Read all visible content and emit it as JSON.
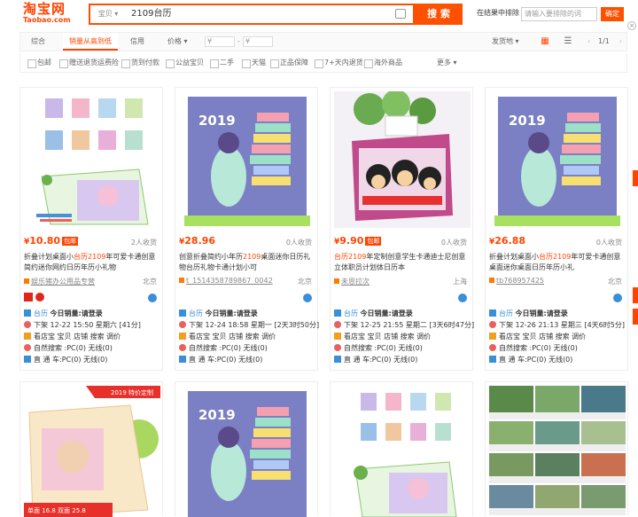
{
  "header": {
    "logo_cn": "淘宝网",
    "logo_en": "Taobao.com",
    "category": "宝贝",
    "search_value": "2109台历",
    "search_button": "搜 索",
    "search_in_results_label": "在结果中排除",
    "search_in_results_placeholder": "请输入要排除的词",
    "confirm_button": "确定"
  },
  "sort": {
    "items": [
      "综合",
      "销量从高到低",
      "信用",
      "价格"
    ],
    "price_from": "¥",
    "price_to": "¥",
    "ship_from": "发货地",
    "page": "1/1",
    "active_color": "#ff4400"
  },
  "filters": [
    "包邮",
    "赠送退货运费险",
    "货到付款",
    "公益宝贝",
    "二手",
    "天猫",
    "正品保障",
    "7+天内退货",
    "海外商品",
    "更多"
  ],
  "products": [
    {
      "price": "10.80",
      "badge": "包邮",
      "buyers": "2人收货",
      "title_a": "折叠计划桌面小",
      "title_hl": "台历2109",
      "title_b": "年可爱卡通创意简约迷你网约日历年历小礼物",
      "shop": "娱乐猪办公用品专营",
      "location": "北京",
      "ext_title": "台历",
      "today_sales": "今日销量:请登录",
      "offline": "下架 12-22 15:50 星期六 [41分]",
      "competitor": "看店宝 宝贝 店铺 搜索 调价",
      "natural": "自然搜索 :PC(0) 无线(0)",
      "direct": "直 通 车:PC(0) 无线(0)"
    },
    {
      "price": "28.96",
      "badge": "",
      "buyers": "0人收货",
      "title_a": "创意折叠简约小年历",
      "title_hl": "2109",
      "title_b": "桌面迷你日历礼物台历礼物卡通计划小可",
      "shop": "t_1514358789867_0042",
      "location": "北京",
      "ext_title": "台历",
      "today_sales": "今日销量:请登录",
      "offline": "下架 12-24 18:58 星期一 [2天3时50分]",
      "competitor": "看店宝 宝贝 店铺 搜索 调价",
      "natural": "自然搜索 :PC(0) 无线(0)",
      "direct": "直 通 车:PC(0) 无线(0)"
    },
    {
      "price": "9.90",
      "badge": "包邮",
      "buyers": "0人收货",
      "title_a": "",
      "title_hl": "台历2109",
      "title_b": "年定制创意学生卡通迪士尼创意立体职员计划体日历本",
      "shop": "未恩拉次",
      "location": "上海",
      "ext_title": "台历",
      "today_sales": "今日销量:请登录",
      "offline": "下架 12-25 21:55 星期二 [3天6时47分]",
      "competitor": "看店宝 宝贝 店铺 搜索 调价",
      "natural": "自然搜索 :PC(0) 无线(0)",
      "direct": "直 通 车:PC(0) 无线(0)"
    },
    {
      "price": "26.88",
      "badge": "",
      "buyers": "0人收货",
      "title_a": "折叠计划桌面小",
      "title_hl": "台历2109",
      "title_b": "年可爱卡通创意桌面迷你桌面日历年历小礼",
      "shop": "tb768957425",
      "location": "北京",
      "ext_title": "台历",
      "today_sales": "今日销量:请登录",
      "offline": "下架 12-26 21:13 星期三 [4天6时5分]",
      "competitor": "看店宝 宝贝 店铺 搜索 调价",
      "natural": "自然搜索 :PC(0) 无线(0)",
      "direct": "直 通 车:PC(0) 无线(0)"
    }
  ],
  "row2": {
    "banner": "2019 特价定制",
    "price_line": "单面 16.8 双面 25.8",
    "year": "2019"
  }
}
